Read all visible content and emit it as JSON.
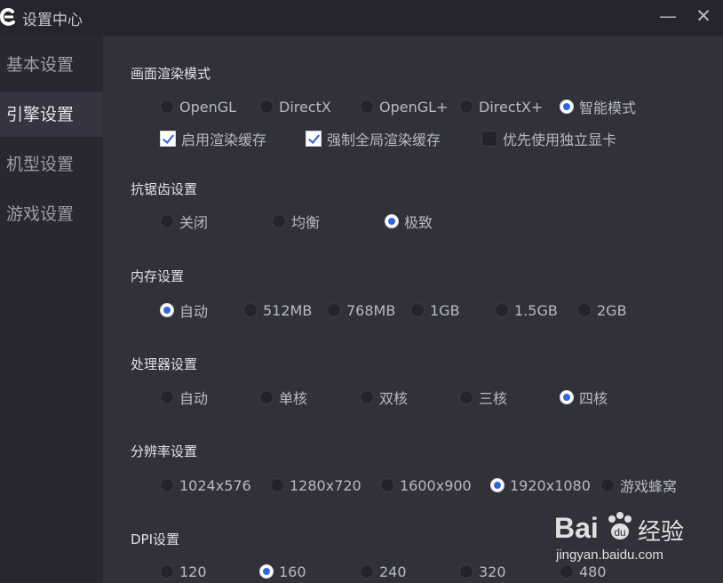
{
  "window": {
    "title": "设置中心",
    "minimize_icon": "—",
    "close_icon": "✕"
  },
  "sidebar": {
    "items": [
      {
        "label": "基本设置",
        "active": false
      },
      {
        "label": "引擎设置",
        "active": true
      },
      {
        "label": "机型设置",
        "active": false
      },
      {
        "label": "游戏设置",
        "active": false
      }
    ]
  },
  "render_mode": {
    "title": "画面渲染模式",
    "options": [
      "OpenGL",
      "DirectX",
      "OpenGL+",
      "DirectX+",
      "智能模式"
    ],
    "selected": "智能模式",
    "checkboxes": [
      {
        "label": "启用渲染缓存",
        "checked": true
      },
      {
        "label": "强制全局渲染缓存",
        "checked": true
      },
      {
        "label": "优先使用独立显卡",
        "checked": false
      }
    ]
  },
  "antialias": {
    "title": "抗锯齿设置",
    "options": [
      "关闭",
      "均衡",
      "极致"
    ],
    "selected": "极致"
  },
  "memory": {
    "title": "内存设置",
    "options": [
      "自动",
      "512MB",
      "768MB",
      "1GB",
      "1.5GB",
      "2GB"
    ],
    "selected": "自动"
  },
  "cpu": {
    "title": "处理器设置",
    "options": [
      "自动",
      "单核",
      "双核",
      "三核",
      "四核"
    ],
    "selected": "四核"
  },
  "resolution": {
    "title": "分辨率设置",
    "options": [
      "1024x576",
      "1280x720",
      "1600x900",
      "1920x1080",
      "游戏蜂窝"
    ],
    "selected": "1920x1080"
  },
  "dpi": {
    "title": "DPI设置",
    "options": [
      "120",
      "160",
      "240",
      "320",
      "480"
    ],
    "selected": "160"
  },
  "watermark": {
    "brand": "Bai",
    "brand2": "经验",
    "url": "jingyan.baidu.com"
  }
}
